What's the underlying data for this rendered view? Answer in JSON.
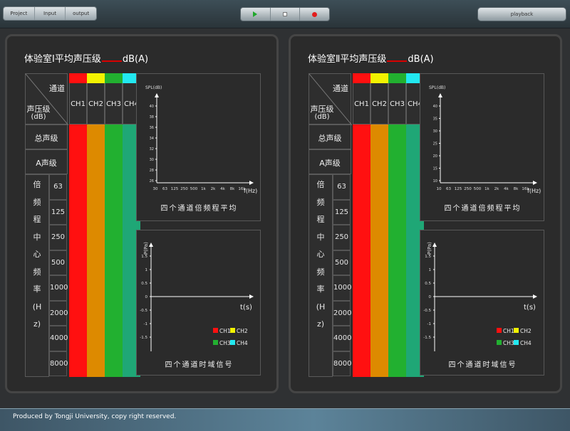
{
  "menu": [
    "Project",
    "Input",
    "output"
  ],
  "playback_label": "playback",
  "colors": {
    "ch1": "#ff1010",
    "ch2": "#dd8a00",
    "ch3": "#22b030",
    "ch4": "#1fa776",
    "ch2_head": "#f2f200",
    "ch4_head": "#22e8f0"
  },
  "panels": [
    {
      "title_prefix": "体验室Ⅰ平均声压级",
      "title_suffix": "dB(A)",
      "header": {
        "channel_label": "通道",
        "level_label": "声压级",
        "unit_label": "(dB)"
      },
      "channels": [
        "CH1",
        "CH2",
        "CH3",
        "CH4"
      ],
      "rows": {
        "total": "总声级",
        "a": "A声级"
      },
      "band_label": "倍频程中心频率(Hz)",
      "bands": [
        "63",
        "125",
        "250",
        "500",
        "1000",
        "2000",
        "4000",
        "8000"
      ],
      "spl_ylabel": "SPL(dB)",
      "spl_yticks": [
        "40",
        "38",
        "36",
        "34",
        "32",
        "30",
        "28",
        "26"
      ],
      "spl_xticks": [
        "30",
        "63",
        "125",
        "250",
        "500",
        "1k",
        "2k",
        "4k",
        "8k",
        "16k"
      ],
      "spl_xunit": "f(Hz)",
      "spl_caption": "四个通道倍频程平均",
      "time_ylabel": "P(Pa)",
      "time_yticks": [
        "1.5",
        "1",
        "0.5",
        "0",
        "-0.5",
        "-1",
        "-1.5"
      ],
      "time_xlabel": "t(s)",
      "time_caption": "四个通道时域信号",
      "legend": [
        "CH1",
        "CH2",
        "CH3",
        "CH4"
      ]
    },
    {
      "title_prefix": "体验室Ⅱ平均声压级",
      "title_suffix": "dB(A)",
      "header": {
        "channel_label": "通道",
        "level_label": "声压级",
        "unit_label": "(dB)"
      },
      "channels": [
        "CH1",
        "CH2",
        "CH3",
        "CH4"
      ],
      "rows": {
        "total": "总声级",
        "a": "A声级"
      },
      "band_label": "倍频程中心频率(Hz)",
      "bands": [
        "63",
        "125",
        "250",
        "500",
        "1000",
        "2000",
        "4000",
        "8000"
      ],
      "spl_ylabel": "SPL(dB)",
      "spl_yticks": [
        "40",
        "35",
        "30",
        "25",
        "20",
        "15",
        "10"
      ],
      "spl_xticks": [
        "10",
        "63",
        "125",
        "250",
        "500",
        "1k",
        "2k",
        "4k",
        "8k",
        "16k"
      ],
      "spl_xunit": "f(Hz)",
      "spl_caption": "四个通道倍频程平均",
      "time_ylabel": "P(Pa)",
      "time_yticks": [
        "1.5",
        "1",
        "0.5",
        "0",
        "-0.5",
        "-1",
        "-1.5"
      ],
      "time_xlabel": "t(s)",
      "time_caption": "四个通道时域信号",
      "legend": [
        "CH1",
        "CH2",
        "CH3",
        "CH4"
      ]
    }
  ],
  "footer_text": "Produced by Tongji University, copy right reserved."
}
